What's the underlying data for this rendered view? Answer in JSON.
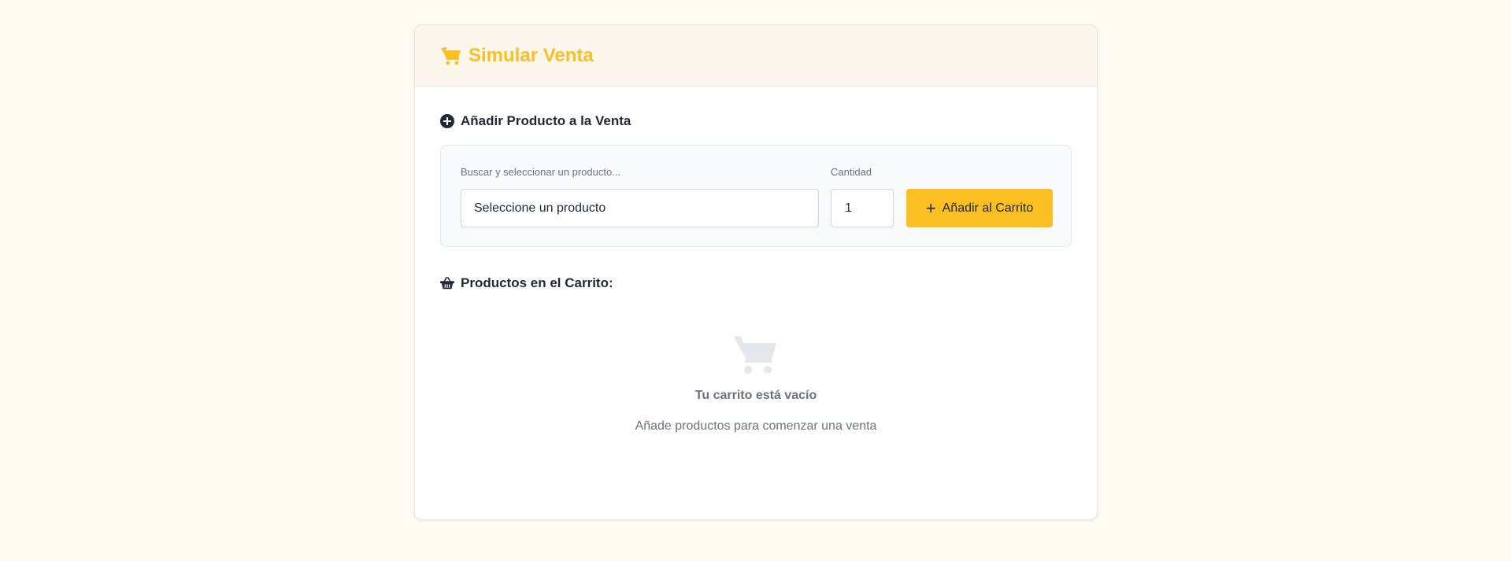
{
  "header": {
    "title": "Simular Venta",
    "icon": "shopping-cart-icon",
    "accent_color": "#fbbf24"
  },
  "add_section": {
    "title": "Añadir Producto a la Venta",
    "icon": "plus-circle-icon",
    "product_label": "Buscar y seleccionar un producto...",
    "product_value": "Seleccione un producto",
    "quantity_label": "Cantidad",
    "quantity_value": "1",
    "add_button_label": "Añadir al Carrito"
  },
  "cart_section": {
    "title": "Productos en el Carrito:",
    "icon": "basket-icon",
    "empty_title": "Tu carrito está vacío",
    "empty_subtitle": "Añade productos para comenzar una venta"
  }
}
